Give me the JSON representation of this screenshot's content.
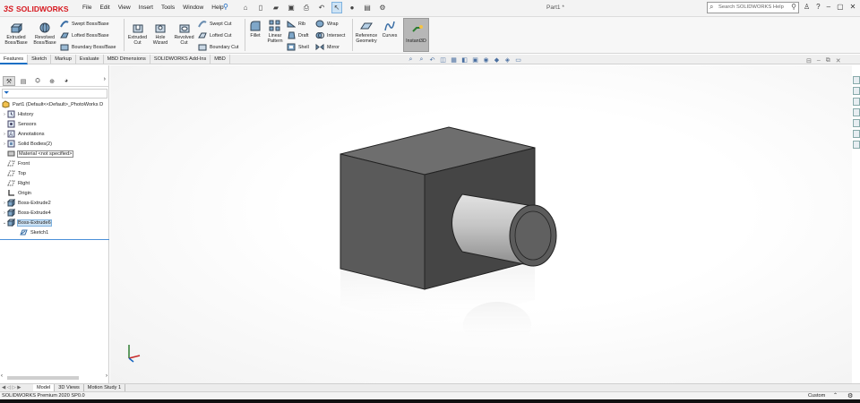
{
  "app": {
    "logo_text": "SOLIDWORKS",
    "doc_title": "Part1 *",
    "search_placeholder": "Search SOLIDWORKS Help"
  },
  "menu": [
    "File",
    "Edit",
    "View",
    "Insert",
    "Tools",
    "Window",
    "Help"
  ],
  "ribbon": {
    "extruded_boss": "Extruded Boss/Base",
    "revolved_boss": "Revolved Boss/Base",
    "swept_boss": "Swept Boss/Base",
    "lofted_boss": "Lofted Boss/Base",
    "boundary_boss": "Boundary Boss/Base",
    "extruded_cut": "Extruded Cut",
    "hole_wizard": "Hole Wizard",
    "revolved_cut": "Revolved Cut",
    "swept_cut": "Swept Cut",
    "lofted_cut": "Lofted Cut",
    "boundary_cut": "Boundary Cut",
    "fillet": "Fillet",
    "linear_pattern": "Linear Pattern",
    "rib": "Rib",
    "draft": "Draft",
    "shell": "Shell",
    "wrap": "Wrap",
    "intersect": "Intersect",
    "mirror": "Mirror",
    "reference_geometry": "Reference Geometry",
    "curves": "Curves",
    "instant3d": "Instant3D"
  },
  "tabs": [
    "Features",
    "Sketch",
    "Markup",
    "Evaluate",
    "MBD Dimensions",
    "SOLIDWORKS Add-Ins",
    "MBD"
  ],
  "active_tab": "Features",
  "tree": {
    "root": "Part1 (Default<<Default>_PhotoWorks D",
    "history": "History",
    "sensors": "Sensors",
    "annotations": "Annotations",
    "solid_bodies": "Solid Bodies(2)",
    "material": "Material <not specified>",
    "front": "Front",
    "top": "Top",
    "right": "Right",
    "origin": "Origin",
    "boss2": "Boss-Extrude2",
    "boss4": "Boss-Extrude4",
    "boss6": "Boss-Extrude6",
    "sketch1": "Sketch1"
  },
  "bottom_tabs": [
    "Model",
    "3D Views",
    "Motion Study 1"
  ],
  "active_bottom_tab": "Model",
  "status": {
    "product": "SOLIDWORKS Premium 2020 SP0.0",
    "units": "Custom"
  },
  "colors": {
    "brand": "#d71920",
    "selection": "#cde3f5",
    "accent": "#1a6fc4"
  }
}
